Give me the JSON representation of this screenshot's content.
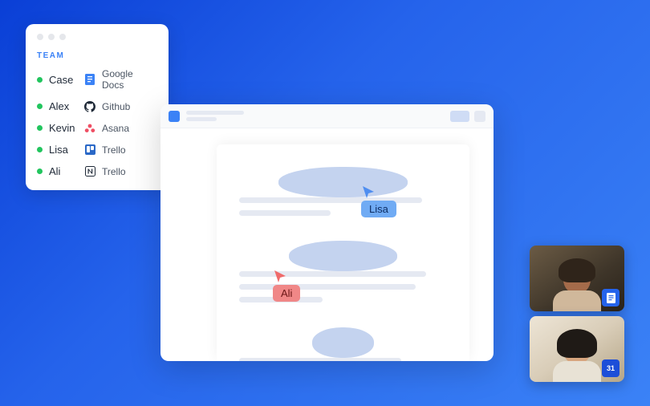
{
  "team_panel": {
    "section_label": "TEAM",
    "members": [
      {
        "name": "Case",
        "status": "online",
        "app_icon": "google-docs",
        "app_name": "Google Docs"
      },
      {
        "name": "Alex",
        "status": "online",
        "app_icon": "github",
        "app_name": "Github"
      },
      {
        "name": "Kevin",
        "status": "online",
        "app_icon": "asana",
        "app_name": "Asana"
      },
      {
        "name": "Lisa",
        "status": "online",
        "app_icon": "trello",
        "app_name": "Trello"
      },
      {
        "name": "Ali",
        "status": "online",
        "app_icon": "notion",
        "app_name": "Trello"
      }
    ]
  },
  "document": {
    "cursors": [
      {
        "user": "Lisa",
        "color": "#4f8ef0"
      },
      {
        "user": "Ali",
        "color": "#ef6b6b"
      }
    ]
  },
  "video_tiles": [
    {
      "badge": "docs-icon"
    },
    {
      "badge": "calendar-icon",
      "badge_text": "31"
    }
  ],
  "colors": {
    "accent_blue": "#3b82f6",
    "status_online": "#22c55e",
    "cursor_lisa": "#4f8ef0",
    "cursor_ali": "#ef6b6b"
  }
}
